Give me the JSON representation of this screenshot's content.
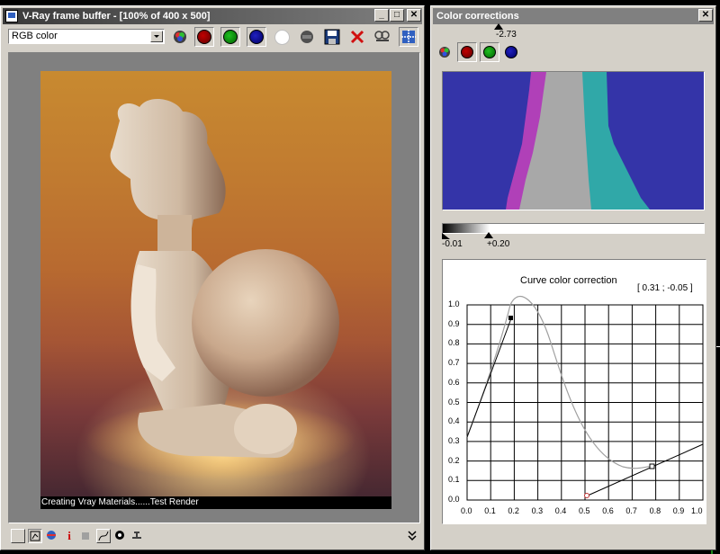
{
  "vfb": {
    "title": "V-Ray frame buffer - [100% of 400 x 500]",
    "channel_select": "RGB color",
    "toolbar_icons": [
      "rgb-channels-icon",
      "red-channel-icon",
      "green-channel-icon",
      "blue-channel-icon",
      "alpha-channel-icon",
      "mono-icon",
      "save-icon",
      "clear-icon",
      "duplicate-icon",
      "region-render-icon"
    ],
    "render_caption": "Creating Vray Materials......Test Render",
    "status_icons": [
      "display-correction-icon",
      "color-corrections-icon",
      "lut-icon",
      "info-icon",
      "pixel-info-icon",
      "curve-icon",
      "lens-effects-icon",
      "stamp-icon",
      "expand-icon"
    ]
  },
  "colorcorr": {
    "title": "Color corrections",
    "exposure_marker": "-2.73",
    "levels_low": "-0.01",
    "levels_high": "+0.20",
    "curve_title": "Curve color correction",
    "curve_readout": "[ 0.31 ; -0.05 ]",
    "y_ticks": [
      "1.0",
      "0.9",
      "0.8",
      "0.7",
      "0.6",
      "0.5",
      "0.4",
      "0.3",
      "0.2",
      "0.1",
      "0.0"
    ],
    "x_ticks": [
      "0.0",
      "0.1",
      "0.2",
      "0.3",
      "0.4",
      "0.5",
      "0.6",
      "0.7",
      "0.8",
      "0.9",
      "1.0"
    ],
    "histogram_colors": {
      "background": "#3434a8",
      "red": "#b040b8",
      "green": "#30a8a8",
      "mid": "#a8a8a8"
    }
  }
}
